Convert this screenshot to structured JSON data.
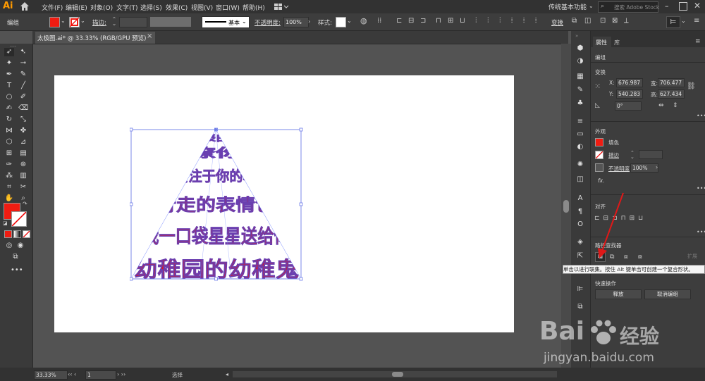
{
  "app": {
    "logo_text": "Ai",
    "workspace_label": "传统基本功能",
    "stock_search_placeholder": "搜索 Adobe Stock"
  },
  "menus": [
    "文件(F)",
    "编辑(E)",
    "对象(O)",
    "文字(T)",
    "选择(S)",
    "效果(C)",
    "视图(V)",
    "窗口(W)",
    "帮助(H)"
  ],
  "control_bar": {
    "selection_label": "编组",
    "stroke_label": "描边:",
    "stroke_profile_label": "基本",
    "opacity_label": "不透明度:",
    "opacity_value": "100%",
    "style_label": "样式:",
    "transform_label": "变换",
    "fill_color": "#f01c12"
  },
  "document": {
    "tab_title": "太极图.ai* @ 33.33% (RGB/GPU 预览)"
  },
  "artwork": {
    "lines": [
      "幼稚园的幼稚鬼",
      "我一口袋星星送给你",
      "行走的表情包",
      "会注于你的心",
      "撩你",
      "表白"
    ]
  },
  "properties": {
    "tabs": [
      "属性",
      "库"
    ],
    "selection_type": "编组",
    "transform_title": "变换",
    "x_label": "X:",
    "x_value": "676.987",
    "y_label": "Y:",
    "y_value": "540.283",
    "w_label": "宽:",
    "w_value": "706.477",
    "h_label": "高:",
    "h_value": "627.434",
    "angle_value": "0°",
    "appearance_title": "外观",
    "fill_label": "填色",
    "stroke_label": "描边",
    "opacity_label": "不透明度",
    "opacity_value": "100%",
    "fx_label": "fx.",
    "align_title": "对齐",
    "pathfinder_title": "路径查找器",
    "pathfinder_expand": "扩展",
    "quick_actions_title": "快速操作",
    "release_button": "释放",
    "ungroup_button": "取消编组"
  },
  "tooltip": "单击以进行联集。按住 Alt 键单击可创建一个复合形状。",
  "status": {
    "zoom": "33.33%",
    "artboard_num": "1",
    "mode": "选择"
  },
  "watermark": {
    "brand": "Bai",
    "brand2": "经验",
    "url": "jingyan.baidu.com"
  }
}
